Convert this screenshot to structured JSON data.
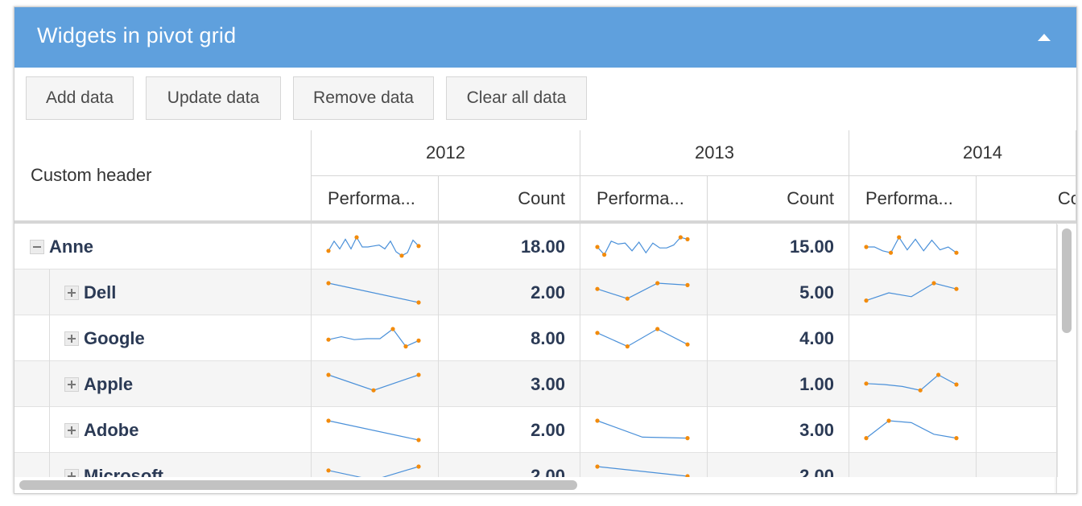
{
  "panel": {
    "title": "Widgets in pivot grid"
  },
  "toolbar": {
    "add_label": "Add data",
    "update_label": "Update data",
    "remove_label": "Remove data",
    "clear_label": "Clear all data"
  },
  "grid": {
    "corner_header": "Custom header",
    "years": [
      "2012",
      "2013",
      "2014"
    ],
    "measure_labels": {
      "performance": "Performa...",
      "count": "Count",
      "count_cut": "Co"
    },
    "rows": [
      {
        "label": "Anne",
        "expanded": true,
        "counts": [
          "18.00",
          "15.00",
          ""
        ],
        "sparks": [
          [
            0.7,
            0.2,
            0.6,
            0.1,
            0.6,
            0.0,
            0.5,
            0.5,
            0.45,
            0.4,
            0.6,
            0.2,
            0.75,
            0.95,
            0.8,
            0.15,
            0.45
          ],
          [
            0.5,
            0.9,
            0.2,
            0.35,
            0.3,
            0.7,
            0.25,
            0.8,
            0.3,
            0.55,
            0.55,
            0.4,
            0.0,
            0.1
          ],
          [
            0.5,
            0.5,
            0.7,
            0.8,
            0.0,
            0.65,
            0.1,
            0.7,
            0.15,
            0.65,
            0.5,
            0.8
          ]
        ]
      },
      {
        "label": "Dell",
        "expanded": false,
        "counts": [
          "2.00",
          "5.00",
          ""
        ],
        "sparks": [
          [
            0.0,
            1.0
          ],
          [
            0.3,
            0.8,
            0.0,
            0.1
          ],
          [
            0.9,
            0.5,
            0.7,
            0.0,
            0.3
          ]
        ]
      },
      {
        "label": "Google",
        "expanded": false,
        "counts": [
          "8.00",
          "4.00",
          ""
        ],
        "sparks": [
          [
            0.55,
            0.4,
            0.55,
            0.5,
            0.5,
            0.0,
            0.9,
            0.6
          ],
          [
            0.2,
            0.9,
            0.0,
            0.8
          ],
          []
        ]
      },
      {
        "label": "Apple",
        "expanded": false,
        "counts": [
          "3.00",
          "1.00",
          ""
        ],
        "sparks": [
          [
            0.0,
            0.8,
            0.0
          ],
          [],
          [
            0.45,
            0.5,
            0.6,
            0.8,
            0.0,
            0.5
          ]
        ]
      },
      {
        "label": "Adobe",
        "expanded": false,
        "counts": [
          "2.00",
          "3.00",
          ""
        ],
        "sparks": [
          [
            0.0,
            1.0
          ],
          [
            0.0,
            0.85,
            0.9
          ],
          [
            0.9,
            0.0,
            0.1,
            0.7,
            0.9
          ]
        ]
      },
      {
        "label": "Microsoft",
        "expanded": false,
        "counts": [
          "2.00",
          "2.00",
          ""
        ],
        "sparks": [
          [
            0.2,
            0.7,
            0.0
          ],
          [
            0.0,
            0.5
          ],
          []
        ]
      }
    ]
  },
  "colors": {
    "header": "#5fa0dd",
    "spark_line": "#4a90d9",
    "spark_marker": "#f28b0c",
    "text_dark": "#2b3a55"
  },
  "icons": {
    "collapse": "chevron-up-icon",
    "expand": "plus-box-icon",
    "collapse_row": "minus-box-icon"
  }
}
